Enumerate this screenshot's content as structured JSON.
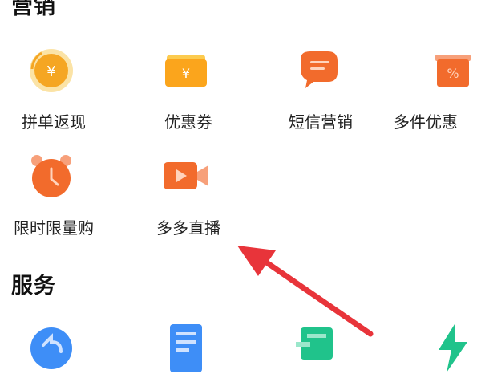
{
  "sections": {
    "marketing": {
      "title": "营销",
      "items": [
        {
          "label": "拼单返现",
          "icon": "cashback-coin-icon",
          "color": "#F5A623"
        },
        {
          "label": "优惠券",
          "icon": "coupon-ticket-icon",
          "color": "#FBA51C"
        },
        {
          "label": "短信营销",
          "icon": "sms-chat-bubble-icon",
          "color": "#F26B2C"
        },
        {
          "label": "多件优惠",
          "icon": "multi-item-discount-bag-icon",
          "color": "#F26B2C"
        },
        {
          "label": "限时限量购",
          "icon": "alarm-clock-icon",
          "color": "#F26B2C"
        },
        {
          "label": "多多直播",
          "icon": "video-camera-icon",
          "color": "#F26B2C"
        }
      ]
    },
    "services": {
      "title": "服务",
      "items": [
        {
          "icon": "return-arrow-icon",
          "color": "#3E8EF7"
        },
        {
          "icon": "document-list-icon",
          "color": "#3E8EF7"
        },
        {
          "icon": "delivery-truck-icon",
          "color": "#20C38B"
        },
        {
          "icon": "lightning-bolt-icon",
          "color": "#20C38B"
        }
      ]
    }
  },
  "annotation": {
    "icon": "red-pointer-arrow",
    "color": "#E8343A"
  }
}
